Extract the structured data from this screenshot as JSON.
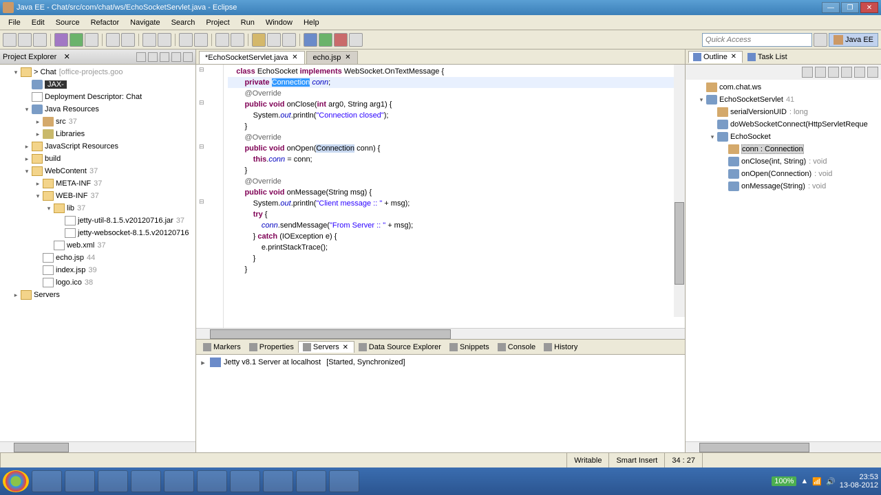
{
  "window": {
    "title": "Java EE - Chat/src/com/chat/ws/EchoSocketServlet.java - Eclipse"
  },
  "menu": [
    "File",
    "Edit",
    "Source",
    "Refactor",
    "Navigate",
    "Search",
    "Project",
    "Run",
    "Window",
    "Help"
  ],
  "quickaccess_placeholder": "Quick Access",
  "perspective": "Java EE",
  "project_explorer": {
    "title": "Project Explorer",
    "items": [
      {
        "indent": 1,
        "exp": "▾",
        "icon": "folder",
        "label": "> Chat",
        "dec": "[office-projects.goo"
      },
      {
        "indent": 2,
        "exp": "",
        "icon": "java",
        "label": "JAX-",
        "black": true
      },
      {
        "indent": 2,
        "exp": "",
        "icon": "file",
        "label": "Deployment Descriptor: Chat"
      },
      {
        "indent": 2,
        "exp": "▾",
        "icon": "java",
        "label": "Java Resources"
      },
      {
        "indent": 3,
        "exp": "▸",
        "icon": "pkg",
        "label": "src",
        "dec": "37"
      },
      {
        "indent": 3,
        "exp": "▸",
        "icon": "lib",
        "label": "Libraries"
      },
      {
        "indent": 2,
        "exp": "▸",
        "icon": "folder",
        "label": "JavaScript Resources"
      },
      {
        "indent": 2,
        "exp": "▸",
        "icon": "folder",
        "label": "build"
      },
      {
        "indent": 2,
        "exp": "▾",
        "icon": "folder",
        "label": "WebContent",
        "dec": "37"
      },
      {
        "indent": 3,
        "exp": "▸",
        "icon": "folder",
        "label": "META-INF",
        "dec": "37"
      },
      {
        "indent": 3,
        "exp": "▾",
        "icon": "folder",
        "label": "WEB-INF",
        "dec": "37"
      },
      {
        "indent": 4,
        "exp": "▾",
        "icon": "folder",
        "label": "lib",
        "dec": "37"
      },
      {
        "indent": 5,
        "exp": "",
        "icon": "file",
        "label": "jetty-util-8.1.5.v20120716.jar",
        "dec": "37"
      },
      {
        "indent": 5,
        "exp": "",
        "icon": "file",
        "label": "jetty-websocket-8.1.5.v20120716"
      },
      {
        "indent": 4,
        "exp": "",
        "icon": "file",
        "label": "web.xml",
        "dec": "37"
      },
      {
        "indent": 3,
        "exp": "",
        "icon": "file",
        "label": "echo.jsp",
        "dec": "44"
      },
      {
        "indent": 3,
        "exp": "",
        "icon": "file",
        "label": "index.jsp",
        "dec": "39"
      },
      {
        "indent": 3,
        "exp": "",
        "icon": "file",
        "label": "logo.ico",
        "dec": "38"
      },
      {
        "indent": 1,
        "exp": "▸",
        "icon": "folder",
        "label": "Servers"
      }
    ]
  },
  "editor": {
    "tabs": [
      {
        "label": "*EchoSocketServlet.java",
        "active": true
      },
      {
        "label": "echo.jsp",
        "active": false
      }
    ],
    "lines": [
      {
        "t": "    <kw>class</kw> EchoSocket <kw>implements</kw> WebSocket.OnTextMessage {"
      },
      {
        "t": "        <kw>private</kw> <sel>Connection</sel> <fld>conn</fld>;",
        "hl": true
      },
      {
        "t": "        <ann>@Override</ann>"
      },
      {
        "t": "        <kw>public void</kw> onClose(<kw>int</kw> arg0, String arg1) {"
      },
      {
        "t": "            System.<fld>out</fld>.println(<str>\"Connection closed\"</str>);"
      },
      {
        "t": "        }"
      },
      {
        "t": ""
      },
      {
        "t": "        <ann>@Override</ann>"
      },
      {
        "t": "        <kw>public void</kw> onOpen(<hl>Connection</hl> conn) {"
      },
      {
        "t": "            <kw>this</kw>.<fld>conn</fld> = conn;"
      },
      {
        "t": "        }"
      },
      {
        "t": ""
      },
      {
        "t": "        <ann>@Override</ann>"
      },
      {
        "t": "        <kw>public void</kw> onMessage(String msg) {"
      },
      {
        "t": "            System.<fld>out</fld>.println(<str>\"Client message :: \"</str> + msg);"
      },
      {
        "t": "            <kw>try</kw> {"
      },
      {
        "t": "                <fld>conn</fld>.sendMessage(<str>\"From Server :: \"</str> + msg);"
      },
      {
        "t": "            } <kw>catch</kw> (IOException e) {"
      },
      {
        "t": "                e.printStackTrace();"
      },
      {
        "t": "            }"
      },
      {
        "t": "        }"
      }
    ]
  },
  "outline": {
    "title": "Outline",
    "tasklist": "Task List",
    "items": [
      {
        "indent": 1,
        "exp": "",
        "icon": "pkg",
        "label": "com.chat.ws"
      },
      {
        "indent": 1,
        "exp": "▾",
        "icon": "java",
        "label": "EchoSocketServlet",
        "dec": "41"
      },
      {
        "indent": 2,
        "exp": "",
        "icon": "fld",
        "label": "serialVersionUID",
        "ret": ": long"
      },
      {
        "indent": 2,
        "exp": "",
        "icon": "mth",
        "label": "doWebSocketConnect(HttpServletReque"
      },
      {
        "indent": 2,
        "exp": "▾",
        "icon": "java",
        "label": "EchoSocket"
      },
      {
        "indent": 3,
        "exp": "",
        "icon": "fld",
        "label": "conn : Connection",
        "hl": true
      },
      {
        "indent": 3,
        "exp": "",
        "icon": "mth",
        "label": "onClose(int, String)",
        "ret": ": void"
      },
      {
        "indent": 3,
        "exp": "",
        "icon": "mth",
        "label": "onOpen(Connection)",
        "ret": ": void"
      },
      {
        "indent": 3,
        "exp": "",
        "icon": "mth",
        "label": "onMessage(String)",
        "ret": ": void"
      }
    ]
  },
  "bottom": {
    "tabs": [
      "Markers",
      "Properties",
      "Servers",
      "Data Source Explorer",
      "Snippets",
      "Console",
      "History"
    ],
    "active": 2,
    "server": "Jetty v8.1 Server at localhost",
    "server_state": "[Started, Synchronized]"
  },
  "status": {
    "writable": "Writable",
    "insert": "Smart Insert",
    "pos": "34 : 27"
  },
  "taskbar": {
    "zoom": "100%",
    "time": "23:53",
    "date": "13-08-2012"
  }
}
